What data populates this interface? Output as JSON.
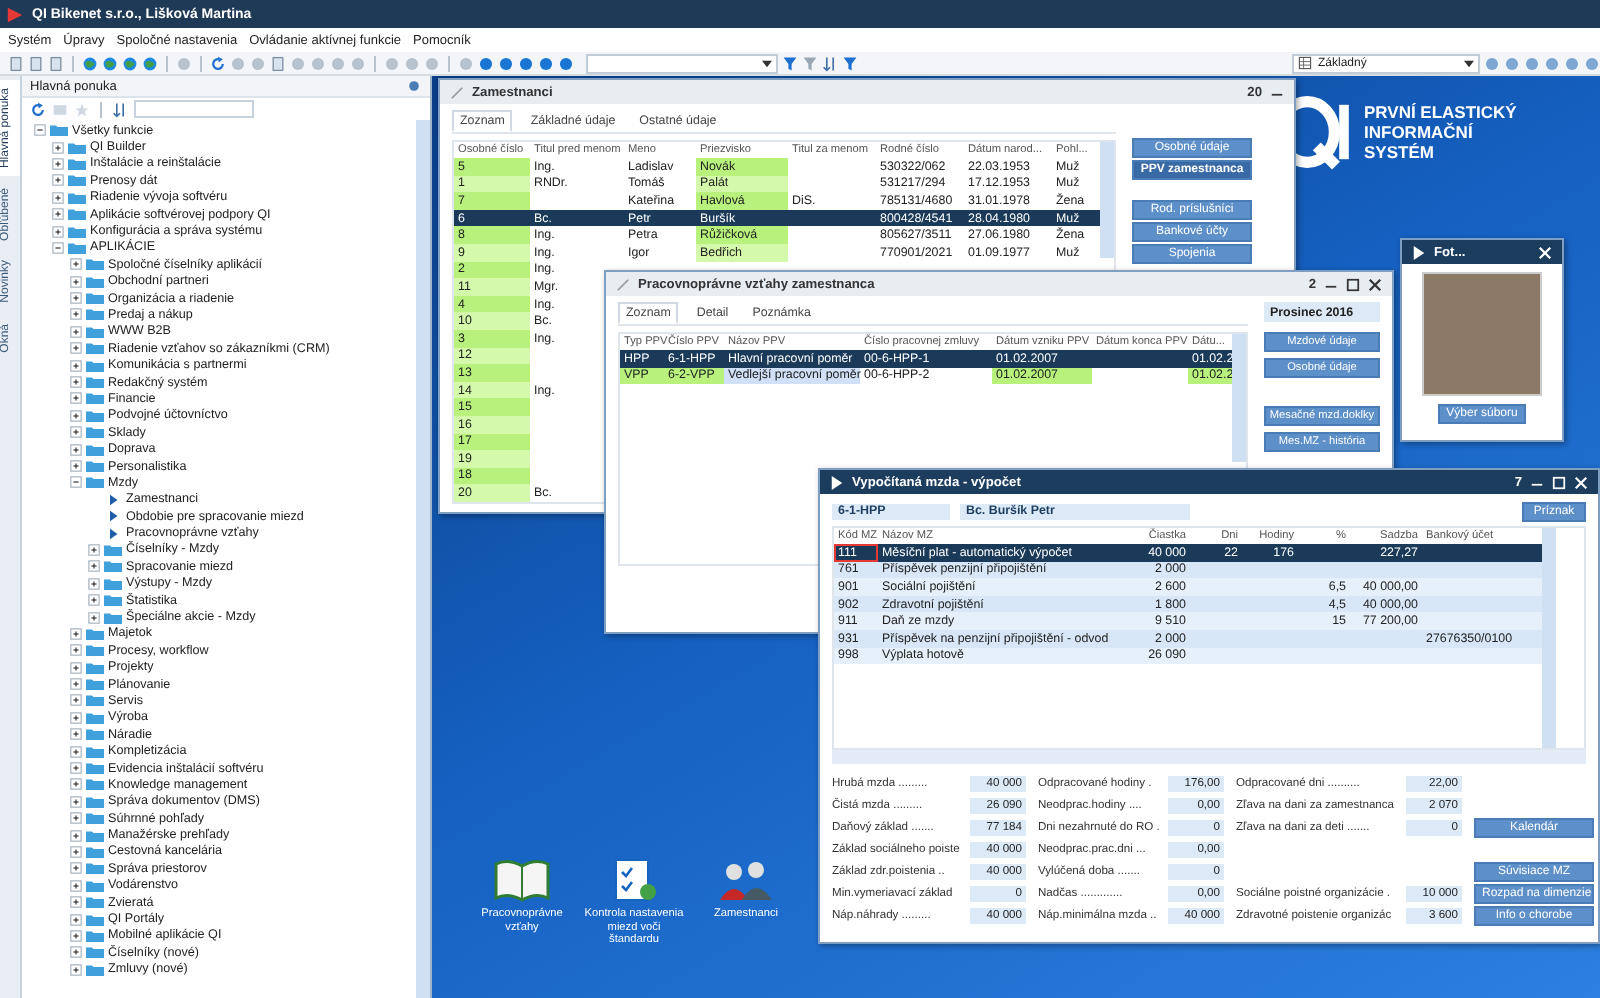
{
  "window": {
    "title": "QI Bikenet s.r.o., Lišková Martina"
  },
  "menu": [
    "Systém",
    "Úpravy",
    "Spoločné nastavenia",
    "Ovládanie aktívnej funkcie",
    "Pomocník"
  ],
  "toolbar": {
    "view_dropdown": "Základný"
  },
  "side_tabs": [
    {
      "label": "Hlavná ponuka",
      "selected": true
    },
    {
      "label": "Obľúbené",
      "selected": false
    },
    {
      "label": "Novinky",
      "selected": false
    },
    {
      "label": "Okná",
      "selected": false
    }
  ],
  "main_menu": {
    "title": "Hlavná ponuka",
    "tree": [
      {
        "label": "Všetky funkcie",
        "kind": "folder",
        "expanded": true,
        "children": [
          {
            "label": "QI Builder",
            "kind": "folder",
            "expanded": false
          },
          {
            "label": "Inštalácie a reinštalácie",
            "kind": "folder",
            "expanded": false
          },
          {
            "label": "Prenosy dát",
            "kind": "folder",
            "expanded": false
          },
          {
            "label": "Riadenie vývoja softvéru",
            "kind": "folder",
            "expanded": false
          },
          {
            "label": "Aplikácie softvérovej podpory QI",
            "kind": "folder",
            "expanded": false
          },
          {
            "label": "Konfigurácia a správa systému",
            "kind": "folder",
            "expanded": false
          },
          {
            "label": "APLIKÁCIE",
            "kind": "folder",
            "expanded": true,
            "children": [
              {
                "label": "Spoločné číselníky aplikácií",
                "kind": "folder",
                "expanded": false
              },
              {
                "label": "Obchodní partneri",
                "kind": "folder",
                "expanded": false
              },
              {
                "label": "Organizácia a riadenie",
                "kind": "folder",
                "expanded": false
              },
              {
                "label": "Predaj a nákup",
                "kind": "folder",
                "expanded": false
              },
              {
                "label": "WWW B2B",
                "kind": "folder",
                "expanded": false
              },
              {
                "label": "Riadenie vzťahov so zákazníkmi (CRM)",
                "kind": "folder",
                "expanded": false
              },
              {
                "label": "Komunikácia s partnermi",
                "kind": "folder",
                "expanded": false
              },
              {
                "label": "Redakčný systém",
                "kind": "folder",
                "expanded": false
              },
              {
                "label": "Financie",
                "kind": "folder",
                "expanded": false
              },
              {
                "label": "Podvojné účtovníctvo",
                "kind": "folder",
                "expanded": false
              },
              {
                "label": "Sklady",
                "kind": "folder",
                "expanded": false
              },
              {
                "label": "Doprava",
                "kind": "folder",
                "expanded": false
              },
              {
                "label": "Personalistika",
                "kind": "folder",
                "expanded": false
              },
              {
                "label": "Mzdy",
                "kind": "folder",
                "expanded": true,
                "children": [
                  {
                    "label": "Zamestnanci",
                    "kind": "function"
                  },
                  {
                    "label": "Obdobie pre spracovanie miezd",
                    "kind": "function"
                  },
                  {
                    "label": "Pracovnoprávne vzťahy",
                    "kind": "function"
                  },
                  {
                    "label": "Číselníky - Mzdy",
                    "kind": "folder",
                    "expanded": false
                  },
                  {
                    "label": "Spracovanie miezd",
                    "kind": "folder",
                    "expanded": false
                  },
                  {
                    "label": "Výstupy - Mzdy",
                    "kind": "folder",
                    "expanded": false
                  },
                  {
                    "label": "Štatistika",
                    "kind": "folder",
                    "expanded": false
                  },
                  {
                    "label": "Špeciálne akcie - Mzdy",
                    "kind": "folder",
                    "expanded": false
                  }
                ]
              },
              {
                "label": "Majetok",
                "kind": "folder",
                "expanded": false
              },
              {
                "label": "Procesy, workflow",
                "kind": "folder",
                "expanded": false
              },
              {
                "label": "Projekty",
                "kind": "folder",
                "expanded": false
              },
              {
                "label": "Plánovanie",
                "kind": "folder",
                "expanded": false
              },
              {
                "label": "Servis",
                "kind": "folder",
                "expanded": false
              },
              {
                "label": "Výroba",
                "kind": "folder",
                "expanded": false
              },
              {
                "label": "Náradie",
                "kind": "folder",
                "expanded": false
              },
              {
                "label": "Kompletizácia",
                "kind": "folder",
                "expanded": false
              },
              {
                "label": "Evidencia inštalácií softvéru",
                "kind": "folder",
                "expanded": false
              },
              {
                "label": "Knowledge management",
                "kind": "folder",
                "expanded": false
              },
              {
                "label": "Správa dokumentov (DMS)",
                "kind": "folder",
                "expanded": false
              },
              {
                "label": "Súhrnné pohľady",
                "kind": "folder",
                "expanded": false
              },
              {
                "label": "Manažérske prehľady",
                "kind": "folder",
                "expanded": false
              },
              {
                "label": "Cestovná kancelária",
                "kind": "folder",
                "expanded": false
              },
              {
                "label": "Správa priestorov",
                "kind": "folder",
                "expanded": false
              },
              {
                "label": "Vodárenstvo",
                "kind": "folder",
                "expanded": false
              },
              {
                "label": "Zvieratá",
                "kind": "folder",
                "expanded": false
              },
              {
                "label": "QI Portály",
                "kind": "folder",
                "expanded": false
              },
              {
                "label": "Mobilné aplikácie QI",
                "kind": "folder",
                "expanded": false
              },
              {
                "label": "Číselníky (nové)",
                "kind": "folder",
                "expanded": false
              },
              {
                "label": "Zmluvy (nové)",
                "kind": "folder",
                "expanded": false
              }
            ]
          }
        ]
      }
    ]
  },
  "desktop": {
    "logo_lines": [
      "PRVNÍ ELASTICKÝ",
      "INFORMAČNÍ",
      "SYSTÉM"
    ],
    "shortcuts": [
      {
        "label": "Pracovnoprávne vzťahy",
        "kind": "book"
      },
      {
        "label": "Kontrola nastavenia miezd voči štandardu",
        "kind": "checklist"
      },
      {
        "label": "Zamestnanci",
        "kind": "people"
      }
    ]
  },
  "employees_window": {
    "title": "Zamestnanci",
    "count": "20",
    "tabs": [
      {
        "label": "Zoznam",
        "selected": true
      },
      {
        "label": "Základné údaje",
        "selected": false
      },
      {
        "label": "Ostatné údaje",
        "selected": false
      }
    ],
    "columns": [
      "Osobné číslo",
      "Titul pred menom",
      "Meno",
      "Priezvisko",
      "Titul za menom",
      "Rodné číslo",
      "Dátum narod...",
      "Pohl..."
    ],
    "rows": [
      {
        "cells": [
          "5",
          "Ing.",
          "Ladislav",
          "Novák",
          "",
          "530322/062",
          "22.03.1953",
          "Muž"
        ],
        "selected": false
      },
      {
        "cells": [
          "1",
          "RNDr.",
          "Tomáš",
          "Palát",
          "",
          "531217/294",
          "17.12.1953",
          "Muž"
        ],
        "selected": false
      },
      {
        "cells": [
          "7",
          "",
          "Kateřina",
          "Havlová",
          "DiS.",
          "785131/4680",
          "31.01.1978",
          "Žena"
        ],
        "selected": false
      },
      {
        "cells": [
          "6",
          "Bc.",
          "Petr",
          "Buršík",
          "",
          "800428/4541",
          "28.04.1980",
          "Muž"
        ],
        "selected": true
      },
      {
        "cells": [
          "8",
          "Ing.",
          "Petra",
          "Růžičková",
          "",
          "805627/3511",
          "27.06.1980",
          "Žena"
        ],
        "selected": false
      },
      {
        "cells": [
          "9",
          "Ing.",
          "Igor",
          "Bedřich",
          "",
          "770901/2021",
          "01.09.1977",
          "Muž"
        ],
        "selected": false
      },
      {
        "cells": [
          "2",
          "Ing."
        ],
        "selected": false
      },
      {
        "cells": [
          "11",
          "Mgr."
        ],
        "selected": false
      },
      {
        "cells": [
          "4",
          "Ing."
        ],
        "selected": false
      },
      {
        "cells": [
          "10",
          "Bc."
        ],
        "selected": false
      },
      {
        "cells": [
          "3",
          "Ing."
        ],
        "selected": false
      },
      {
        "cells": [
          "12",
          ""
        ],
        "selected": false
      },
      {
        "cells": [
          "13",
          ""
        ],
        "selected": false
      },
      {
        "cells": [
          "14",
          "Ing."
        ],
        "selected": false
      },
      {
        "cells": [
          "15",
          ""
        ],
        "selected": false
      },
      {
        "cells": [
          "16",
          ""
        ],
        "selected": false
      },
      {
        "cells": [
          "17",
          ""
        ],
        "selected": false
      },
      {
        "cells": [
          "19",
          ""
        ],
        "selected": false
      },
      {
        "cells": [
          "18",
          ""
        ],
        "selected": false
      },
      {
        "cells": [
          "20",
          "Bc."
        ],
        "selected": false
      }
    ],
    "buttons": [
      {
        "label": "Osobné údaje",
        "selected": false
      },
      {
        "label": "PPV zamestnanca",
        "selected": true
      },
      {
        "label": "Rod. príslušníci",
        "selected": false
      },
      {
        "label": "Bankové účty",
        "selected": false
      },
      {
        "label": "Spojenia",
        "selected": false
      }
    ]
  },
  "relations_window": {
    "title": "Pracovnoprávne vzťahy zamestnanca",
    "count": "2",
    "tabs": [
      {
        "label": "Zoznam",
        "selected": true
      },
      {
        "label": "Detail",
        "selected": false
      },
      {
        "label": "Poznámka",
        "selected": false
      }
    ],
    "columns": [
      "Typ PPV",
      "Číslo PPV",
      "Názov PPV",
      "Číslo pracovnej zmluvy",
      "Dátum vzniku PPV",
      "Dátum konca PPV",
      "Dátu..."
    ],
    "rows": [
      {
        "cells": [
          "HPP",
          "6-1-HPP",
          "Hlavní pracovní poměr",
          "00-6-HPP-1",
          "01.02.2007",
          "",
          "01.02.2"
        ],
        "selected": true
      },
      {
        "cells": [
          "VPP",
          "6-2-VPP",
          "Vedlejší pracovní poměr",
          "00-6-HPP-2",
          "01.02.2007",
          "",
          "01.02.2"
        ],
        "selected": false
      }
    ],
    "period": "Prosinec 2016",
    "buttons": [
      "Mzdové údaje",
      "Osobné údaje",
      "Mesačné mzd.doklky",
      "Mes.MZ - história"
    ]
  },
  "photo_window": {
    "title": "Fot...",
    "button": "Výber súboru"
  },
  "wage_window": {
    "title": "Vypočítaná mzda - výpočet",
    "count": "7",
    "contract": "6-1-HPP",
    "employee": "Bc. Buršík Petr",
    "flag_button": "Príznak",
    "columns": [
      "Kód MZ",
      "Názov MZ",
      "Čiastka",
      "Dni",
      "Hodiny",
      "%",
      "Sadzba",
      "Bankový účet"
    ],
    "rows": [
      {
        "cells": [
          "111",
          "Měsíční plat - automatický výpočet",
          "40 000",
          "22",
          "176",
          "",
          "227,27",
          ""
        ],
        "selected": true
      },
      {
        "cells": [
          "761",
          "Příspěvek penzijní připojištění",
          "2 000",
          "",
          "",
          "",
          "",
          ""
        ],
        "selected": false
      },
      {
        "cells": [
          "901",
          "Sociální pojištění",
          "2 600",
          "",
          "",
          "6,5",
          "40 000,00",
          ""
        ],
        "selected": false
      },
      {
        "cells": [
          "902",
          "Zdravotní pojištění",
          "1 800",
          "",
          "",
          "4,5",
          "40 000,00",
          ""
        ],
        "selected": false
      },
      {
        "cells": [
          "911",
          "Daň ze mzdy",
          "9 510",
          "",
          "",
          "15",
          "77 200,00",
          ""
        ],
        "selected": false
      },
      {
        "cells": [
          "931",
          "Příspěvek na penzijní připojištění - odvod",
          "2 000",
          "",
          "",
          "",
          "",
          "27676350/0100"
        ],
        "selected": false
      },
      {
        "cells": [
          "998",
          "Výplata hotově",
          "26 090",
          "",
          "",
          "",
          "",
          ""
        ],
        "selected": false
      }
    ],
    "summary_1": [
      {
        "label": "Hrubá mzda .........",
        "value": "40 000"
      },
      {
        "label": "Čistá mzda .........",
        "value": "26 090"
      },
      {
        "label": "Daňový základ .......",
        "value": "77 184"
      },
      {
        "label": "Základ sociálneho poiste",
        "value": "40 000"
      },
      {
        "label": "Základ zdr.poistenia ..",
        "value": "40 000"
      },
      {
        "label": "Min.vymeriavací základ",
        "value": "0"
      },
      {
        "label": "Náp.náhrady .........",
        "value": "40 000"
      }
    ],
    "summary_2": [
      {
        "label": "Odpracované hodiny .",
        "value": "176,00"
      },
      {
        "label": "Neodprac.hodiny ....",
        "value": "0,00"
      },
      {
        "label": "Dni nezahrnuté do RO .",
        "value": "0"
      },
      {
        "label": "Neodprac.prac.dni ...",
        "value": "0,00"
      },
      {
        "label": "Vylúčená doba .......",
        "value": "0"
      },
      {
        "label": "Nadčas .............",
        "value": "0,00"
      },
      {
        "label": "Náp.minimálna mzda ..",
        "value": "40 000"
      }
    ],
    "summary_3_top": [
      {
        "label": "Odpracované dni ..........",
        "value": "22,00"
      },
      {
        "label": "Zľava na dani za zamestnanca",
        "value": "2 070"
      },
      {
        "label": "Zľava na dani za deti .......",
        "value": "0"
      }
    ],
    "summary_3_bottom": [
      {
        "label": "Sociálne poistné organizácie .",
        "value": "10 000"
      },
      {
        "label": "Zdravotné poistenie organizác",
        "value": "3 600"
      }
    ],
    "calendar_button": "Kalendár",
    "buttons": [
      "Súvisiace MZ",
      "Rozpad na dimenzie",
      "Info o chorobe"
    ]
  }
}
